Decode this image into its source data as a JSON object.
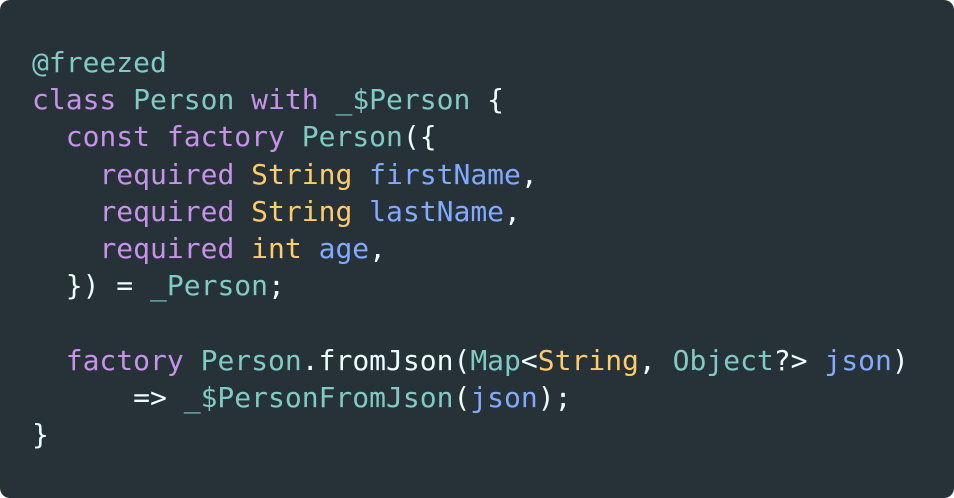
{
  "editor": {
    "background": "#263238",
    "colors": {
      "annotation": "#80cbc4",
      "keyword": "#c792ea",
      "class": "#80cbc4",
      "type": "#ffcb6b",
      "param": "#82aaff",
      "function": "#82aaff",
      "plain": "#eeffff"
    },
    "lines": [
      [
        {
          "text": "@freezed",
          "kind": "annotation"
        }
      ],
      [
        {
          "text": "class",
          "kind": "keyword"
        },
        {
          "text": " ",
          "kind": "plain"
        },
        {
          "text": "Person",
          "kind": "class"
        },
        {
          "text": " ",
          "kind": "plain"
        },
        {
          "text": "with",
          "kind": "keyword"
        },
        {
          "text": " ",
          "kind": "plain"
        },
        {
          "text": "_$Person",
          "kind": "class"
        },
        {
          "text": " {",
          "kind": "plain"
        }
      ],
      [
        {
          "text": "  ",
          "kind": "plain"
        },
        {
          "text": "const",
          "kind": "keyword"
        },
        {
          "text": " ",
          "kind": "plain"
        },
        {
          "text": "factory",
          "kind": "keyword"
        },
        {
          "text": " ",
          "kind": "plain"
        },
        {
          "text": "Person",
          "kind": "class"
        },
        {
          "text": "({",
          "kind": "plain"
        }
      ],
      [
        {
          "text": "    ",
          "kind": "plain"
        },
        {
          "text": "required",
          "kind": "keyword"
        },
        {
          "text": " ",
          "kind": "plain"
        },
        {
          "text": "String",
          "kind": "type"
        },
        {
          "text": " ",
          "kind": "plain"
        },
        {
          "text": "firstName",
          "kind": "param"
        },
        {
          "text": ",",
          "kind": "plain"
        }
      ],
      [
        {
          "text": "    ",
          "kind": "plain"
        },
        {
          "text": "required",
          "kind": "keyword"
        },
        {
          "text": " ",
          "kind": "plain"
        },
        {
          "text": "String",
          "kind": "type"
        },
        {
          "text": " ",
          "kind": "plain"
        },
        {
          "text": "lastName",
          "kind": "param"
        },
        {
          "text": ",",
          "kind": "plain"
        }
      ],
      [
        {
          "text": "    ",
          "kind": "plain"
        },
        {
          "text": "required",
          "kind": "keyword"
        },
        {
          "text": " ",
          "kind": "plain"
        },
        {
          "text": "int",
          "kind": "type"
        },
        {
          "text": " ",
          "kind": "plain"
        },
        {
          "text": "age",
          "kind": "param"
        },
        {
          "text": ",",
          "kind": "plain"
        }
      ],
      [
        {
          "text": "  }) = ",
          "kind": "plain"
        },
        {
          "text": "_Person",
          "kind": "class"
        },
        {
          "text": ";",
          "kind": "plain"
        }
      ],
      [],
      [
        {
          "text": "  ",
          "kind": "plain"
        },
        {
          "text": "factory",
          "kind": "keyword"
        },
        {
          "text": " ",
          "kind": "plain"
        },
        {
          "text": "Person",
          "kind": "class"
        },
        {
          "text": ".",
          "kind": "plain"
        },
        {
          "text": "fromJson",
          "kind": "function"
        },
        {
          "text": "(",
          "kind": "plain"
        },
        {
          "text": "Map",
          "kind": "class"
        },
        {
          "text": "<",
          "kind": "plain"
        },
        {
          "text": "String",
          "kind": "type"
        },
        {
          "text": ", ",
          "kind": "plain"
        },
        {
          "text": "Object",
          "kind": "class"
        },
        {
          "text": "?> ",
          "kind": "plain"
        },
        {
          "text": "json",
          "kind": "param"
        },
        {
          "text": ")",
          "kind": "plain"
        }
      ],
      [
        {
          "text": "      => ",
          "kind": "plain"
        },
        {
          "text": "_$PersonFromJson",
          "kind": "class"
        },
        {
          "text": "(",
          "kind": "plain"
        },
        {
          "text": "json",
          "kind": "param"
        },
        {
          "text": ");",
          "kind": "plain"
        }
      ],
      [
        {
          "text": "}",
          "kind": "plain"
        }
      ]
    ]
  }
}
